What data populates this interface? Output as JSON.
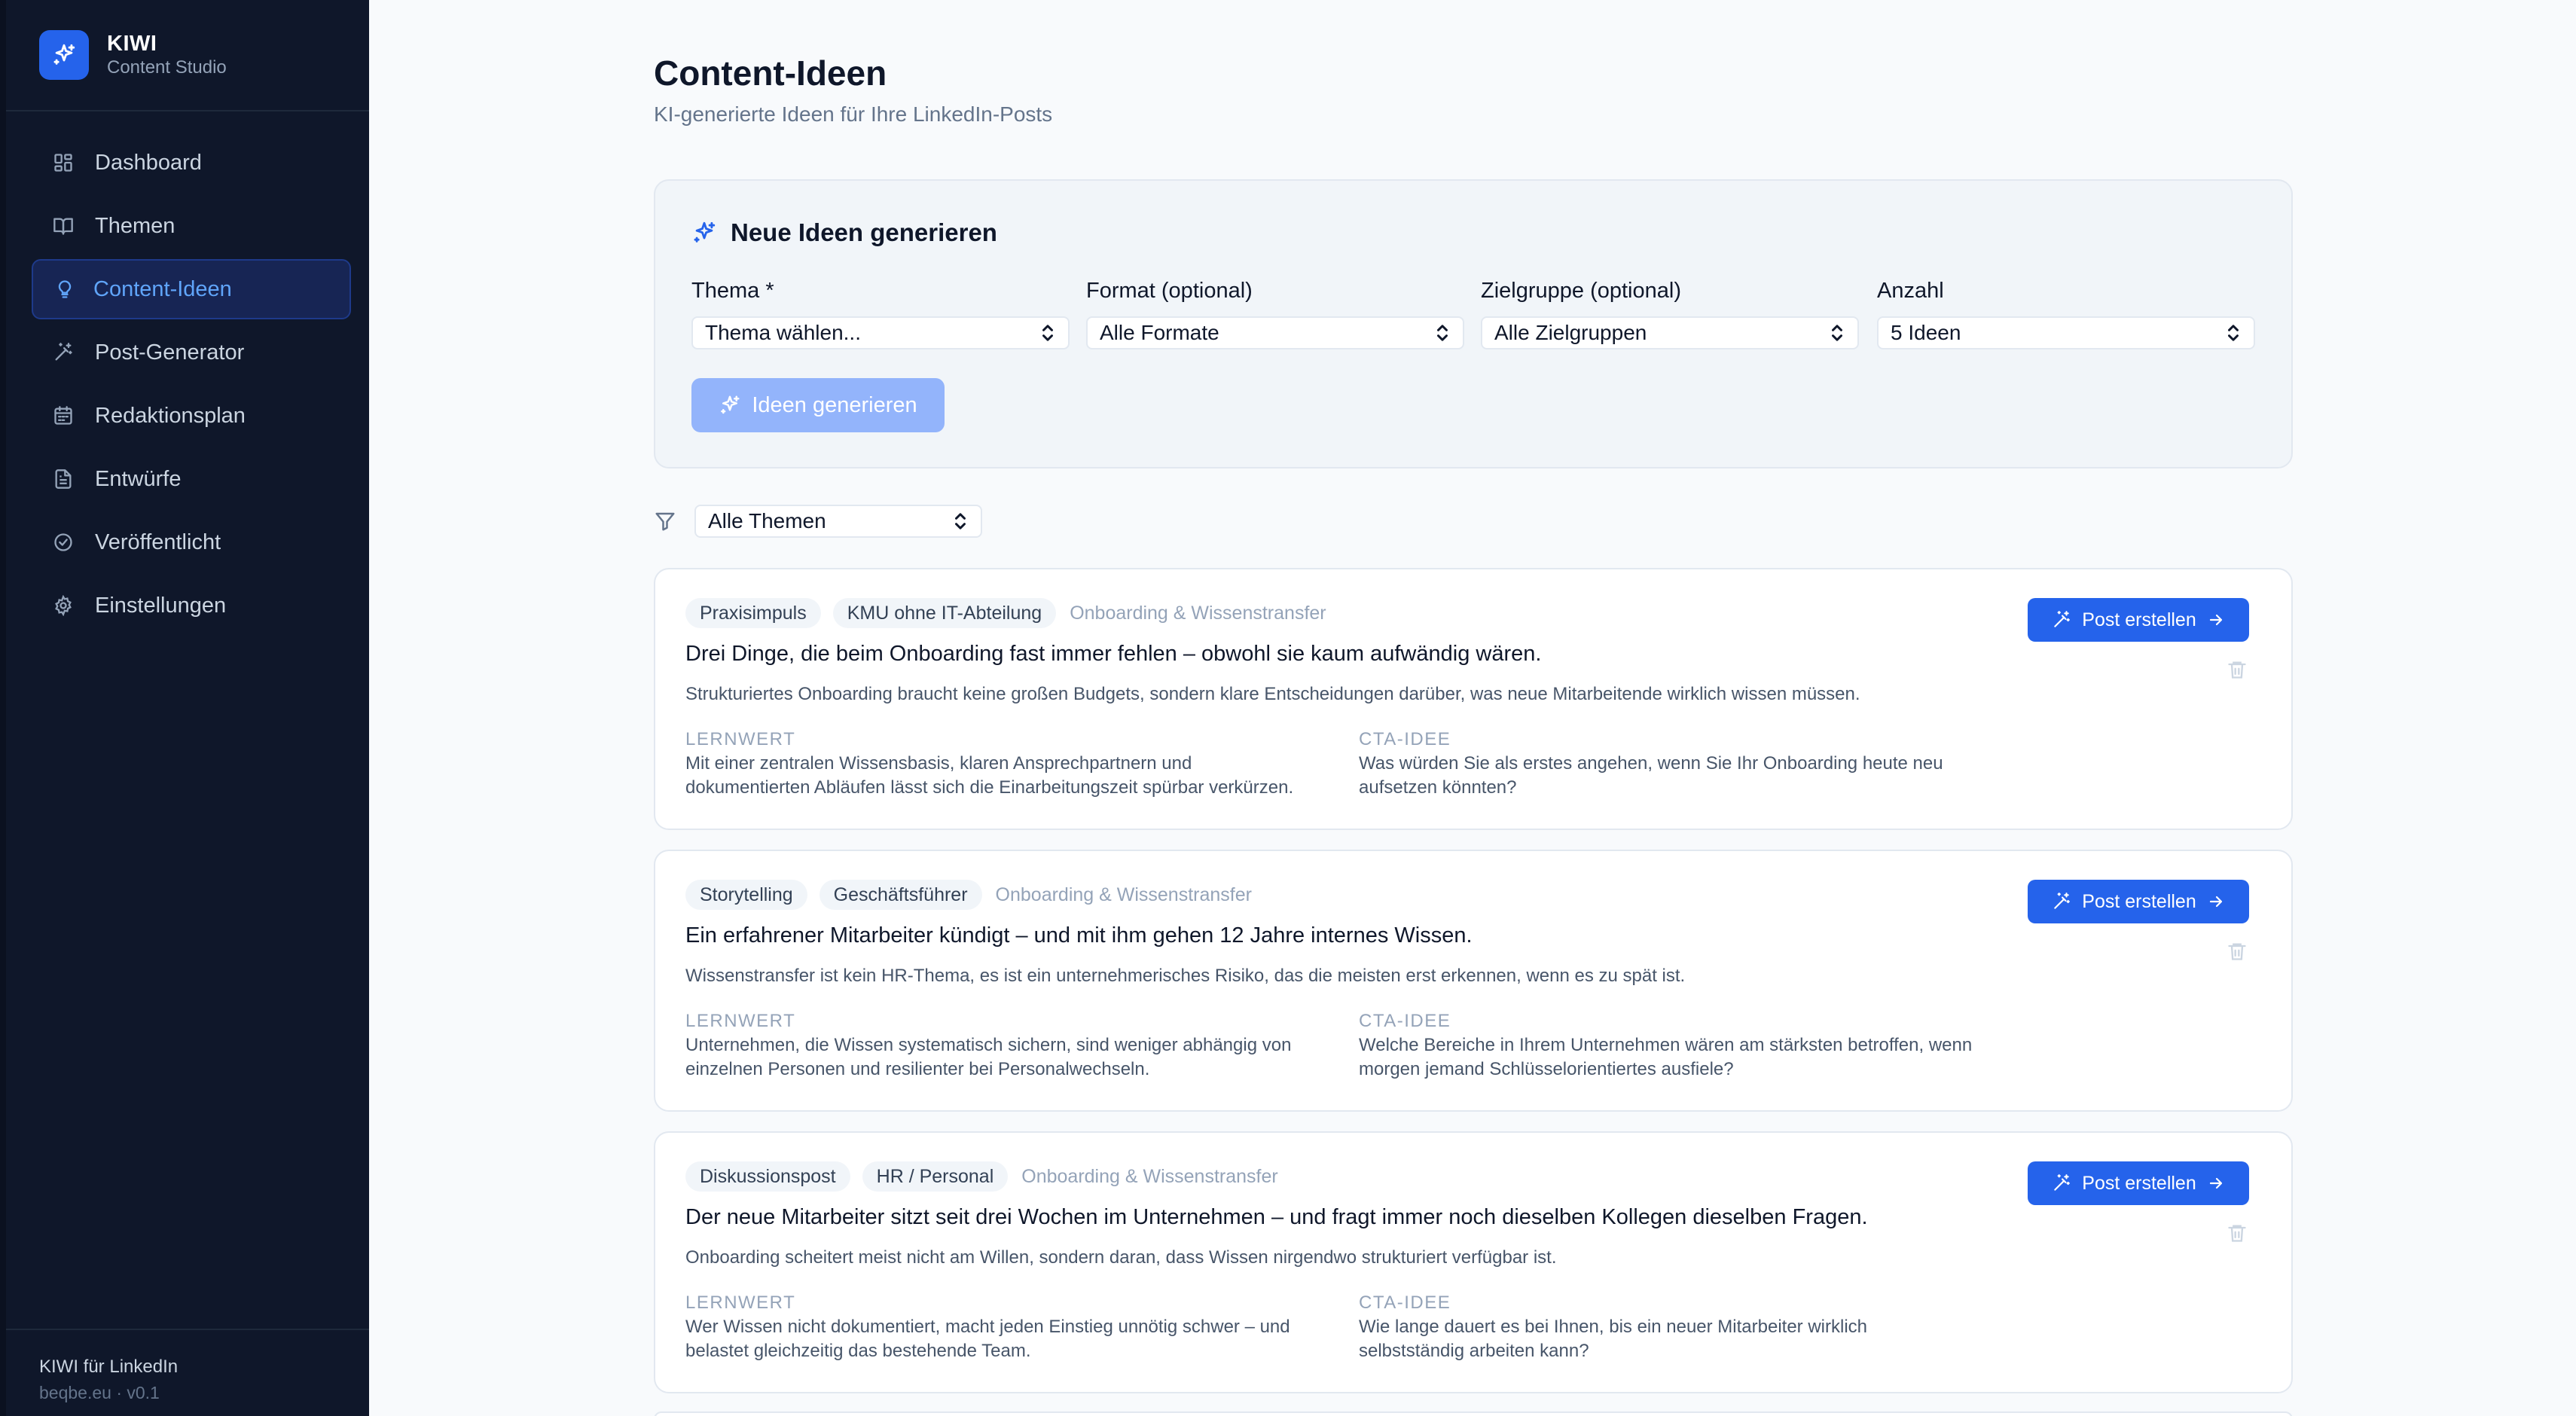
{
  "brand": {
    "name": "KIWI",
    "subtitle": "Content Studio",
    "logo_icon": "sparkles-icon",
    "accent": "#2563eb"
  },
  "sidebar": {
    "items": [
      {
        "label": "Dashboard",
        "icon": "dashboard-grid-icon"
      },
      {
        "label": "Themen",
        "icon": "book-open-icon"
      },
      {
        "label": "Content-Ideen",
        "icon": "lightbulb-icon",
        "active": true
      },
      {
        "label": "Post-Generator",
        "icon": "magic-wand-icon"
      },
      {
        "label": "Redaktionsplan",
        "icon": "calendar-icon"
      },
      {
        "label": "Entwürfe",
        "icon": "document-icon"
      },
      {
        "label": "Veröffentlicht",
        "icon": "check-circle-icon"
      },
      {
        "label": "Einstellungen",
        "icon": "gear-icon"
      }
    ],
    "footer": {
      "title": "KIWI für LinkedIn",
      "meta": "beqbe.eu · v0.1"
    }
  },
  "page": {
    "title": "Content-Ideen",
    "subtitle": "KI-generierte Ideen für Ihre LinkedIn-Posts"
  },
  "generator": {
    "title": "Neue Ideen generieren",
    "fields": [
      {
        "label": "Thema *",
        "value": "Thema wählen..."
      },
      {
        "label": "Format (optional)",
        "value": "Alle Formate"
      },
      {
        "label": "Zielgruppe (optional)",
        "value": "Alle Zielgruppen"
      },
      {
        "label": "Anzahl",
        "value": "5 Ideen"
      }
    ],
    "button_label": "Ideen generieren"
  },
  "filter": {
    "value": "Alle Themen"
  },
  "ideas": [
    {
      "format": "Praxisimpuls",
      "audience": "KMU ohne IT-Abteilung",
      "topic": "Onboarding & Wissenstransfer",
      "title": "Drei Dinge, die beim Onboarding fast immer fehlen – obwohl sie kaum aufwändig wären.",
      "description": "Strukturiertes Onboarding braucht keine großen Budgets, sondern klare Entscheidungen darüber, was neue Mitarbeitende wirklich wissen müssen.",
      "lernwert_label": "LERNWERT",
      "lernwert_line1": "Mit einer zentralen Wissensbasis, klaren Ansprechpartnern und",
      "lernwert_line2": "dokumentierten Abläufen lässt sich die Einarbeitungszeit spürbar verkürzen.",
      "cta_label": "CTA-IDEE",
      "cta_line1": "Was würden Sie als erstes angehen, wenn Sie Ihr Onboarding heute neu",
      "cta_line2": "aufsetzen könnten?",
      "button_label": "Post erstellen"
    },
    {
      "format": "Storytelling",
      "audience": "Geschäftsführer",
      "topic": "Onboarding & Wissenstransfer",
      "title": "Ein erfahrener Mitarbeiter kündigt – und mit ihm gehen 12 Jahre internes Wissen.",
      "description": "Wissenstransfer ist kein HR-Thema, es ist ein unternehmerisches Risiko, das die meisten erst erkennen, wenn es zu spät ist.",
      "lernwert_label": "LERNWERT",
      "lernwert_line1": "Unternehmen, die Wissen systematisch sichern, sind weniger abhängig von",
      "lernwert_line2": "einzelnen Personen und resilienter bei Personalwechseln.",
      "cta_label": "CTA-IDEE",
      "cta_line1": "Welche Bereiche in Ihrem Unternehmen wären am stärksten betroffen, wenn",
      "cta_line2": "morgen jemand Schlüsselorientiertes ausfiele?",
      "button_label": "Post erstellen"
    },
    {
      "format": "Diskussionspost",
      "audience": "HR / Personal",
      "topic": "Onboarding & Wissenstransfer",
      "title": "Der neue Mitarbeiter sitzt seit drei Wochen im Unternehmen – und fragt immer noch dieselben Kollegen dieselben Fragen.",
      "description": "Onboarding scheitert meist nicht am Willen, sondern daran, dass Wissen nirgendwo strukturiert verfügbar ist.",
      "lernwert_label": "LERNWERT",
      "lernwert_line1": "Wer Wissen nicht dokumentiert, macht jeden Einstieg unnötig schwer – und",
      "lernwert_line2": "belastet gleichzeitig das bestehende Team.",
      "cta_label": "CTA-IDEE",
      "cta_line1": "Wie lange dauert es bei Ihnen, bis ein neuer Mitarbeiter wirklich",
      "cta_line2": "selbstständig arbeiten kann?",
      "button_label": "Post erstellen"
    }
  ]
}
